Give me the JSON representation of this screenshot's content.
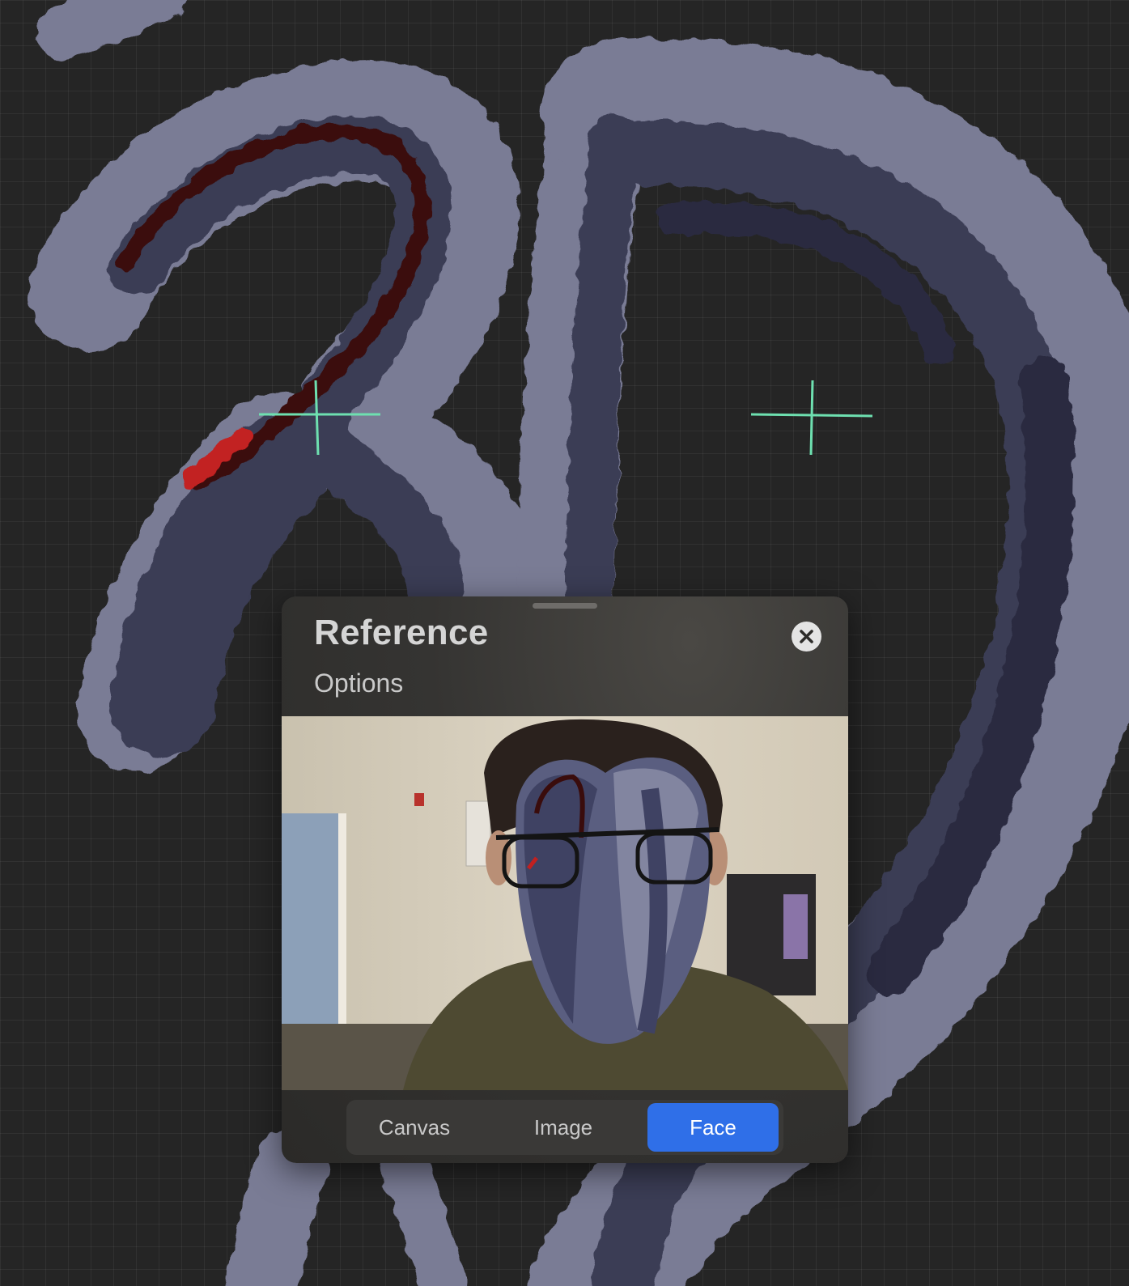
{
  "reference_panel": {
    "title": "Reference",
    "options_label": "Options",
    "close_icon": "close-icon",
    "modes": [
      {
        "label": "Canvas",
        "selected": false
      },
      {
        "label": "Image",
        "selected": false
      },
      {
        "label": "Face",
        "selected": true
      }
    ]
  },
  "colors": {
    "canvas_background": "#252525",
    "stroke_light": "#7a7b95",
    "stroke_dark": "#3b3d55",
    "stroke_red": "#3a0c0c",
    "guide_green": "#6ee0b0",
    "accent_blue": "#2f6fe8"
  }
}
